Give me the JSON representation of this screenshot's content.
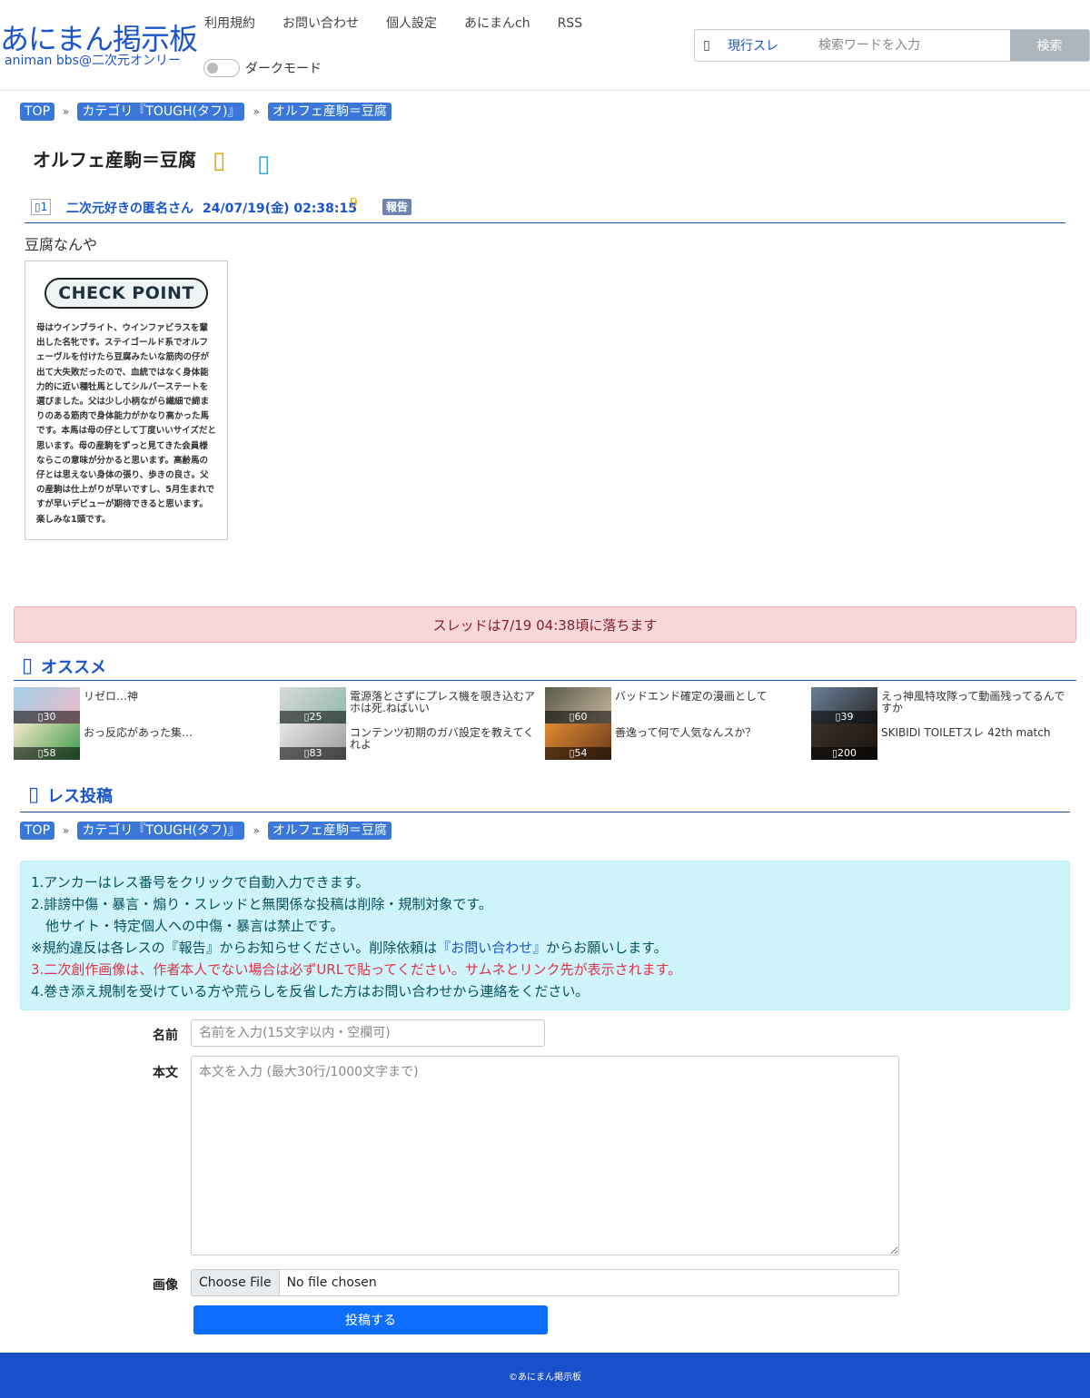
{
  "header": {
    "logo_main": "あにまん掲示板",
    "logo_sub": "animan bbs@二次元オンリー",
    "nav": [
      "利用規約",
      "お問い合わせ",
      "個人設定",
      "あにまんch",
      "RSS"
    ],
    "dark_mode_label": "ダークモード",
    "search": {
      "scope": "現行スレ",
      "placeholder": "検索ワードを入力",
      "button": "検索"
    }
  },
  "breadcrumb": [
    "TOP",
    "カテゴリ『TOUGH(タフ)』",
    "オルフェ産駒＝豆腐"
  ],
  "thread": {
    "title": "オルフェ産駒＝豆腐"
  },
  "post": {
    "number": "1",
    "name": "二次元好きの匿名さん",
    "date": "24/07/19(金) 02:38:15",
    "id": "9",
    "report": "報告",
    "body": "豆腐なんや",
    "image": {
      "badge": "CHECK POINT",
      "text": "母はウインブライト、ウインファビラスを輩出した名牝です。ステイゴールド系でオルフェーヴルを付けたら豆腐みたいな筋肉の仔が出て大失敗だったので、血統ではなく身体能力的に近い種牡馬としてシルバーステートを選びました。父は少し小柄ながら繊細で締まりのある筋肉で身体能力がかなり高かった馬です。本馬は母の仔として丁度いいサイズだと思います。母の産駒をずっと見てきた会員様ならこの意味が分かると思います。高齢馬の仔とは思えない身体の張り、歩きの良さ。父の産駒は仕上がりが早いですし、5月生まれですが早いデビューが期待できると思います。楽しみな1頭です。"
    }
  },
  "alert": "スレッドは7/19 04:38頃に落ちます",
  "recommend": {
    "heading": "オススメ",
    "items": [
      {
        "title": "リゼロ…神",
        "count": "30",
        "color1": "#9fd0e8",
        "color2": "#f2b8c6"
      },
      {
        "title": "電源落とさずにプレス機を覗き込むアホは死.ねばいい",
        "count": "25",
        "color1": "#d9d9d9",
        "color2": "#8fb8a8"
      },
      {
        "title": "バッドエンド確定の漫画として",
        "count": "60",
        "color1": "#5a5a4a",
        "color2": "#c9b8a0"
      },
      {
        "title": "えっ神風特攻隊って動画残ってるんですか",
        "count": "39",
        "color1": "#6a7f99",
        "color2": "#2a2a2a"
      },
      {
        "title": "おっ反応があった集…",
        "count": "58",
        "color1": "#f5e9c8",
        "color2": "#3a9a4a"
      },
      {
        "title": "コンテンツ初期のガバ設定を教えてくれよ",
        "count": "83",
        "color1": "#e8e8e8",
        "color2": "#999999"
      },
      {
        "title": "善逸って何で人気なんスか？",
        "count": "54",
        "color1": "#e08a30",
        "color2": "#6a3a20"
      },
      {
        "title": "SKIBIDI TOILETスレ 42th match",
        "count": "200",
        "color1": "#3a3028",
        "color2": "#1a1410"
      }
    ]
  },
  "post_form": {
    "heading": "レス投稿",
    "rules": {
      "line1": "1.アンカーはレス番号をクリックで自動入力できます。",
      "line2": "2.誹謗中傷・暴言・煽り・スレッドと無関係な投稿は削除・規制対象です。",
      "line2b": "他サイト・特定個人への中傷・暴言は禁止です。",
      "line3a": "※規約違反は各レスの『報告』からお知らせください。削除依頼は",
      "line3link": "『お問い合わせ』",
      "line3b": "からお願いします。",
      "line4a": "3.",
      "line4red": "二次創作画像は、作者本人でない場合は必ずURLで貼ってください。サムネとリンク先が表示されます。",
      "line5": "4.巻き添え規制を受けている方や荒らしを反省した方はお問い合わせから連絡をください。"
    },
    "name_label": "名前",
    "name_placeholder": "名前を入力(15文字以内・空欄可)",
    "body_label": "本文",
    "body_placeholder": "本文を入力 (最大30行/1000文字まで)",
    "image_label": "画像",
    "file_button": "Choose File",
    "file_status": "No file chosen",
    "submit": "投稿する"
  },
  "footer": "©あにまん掲示板"
}
